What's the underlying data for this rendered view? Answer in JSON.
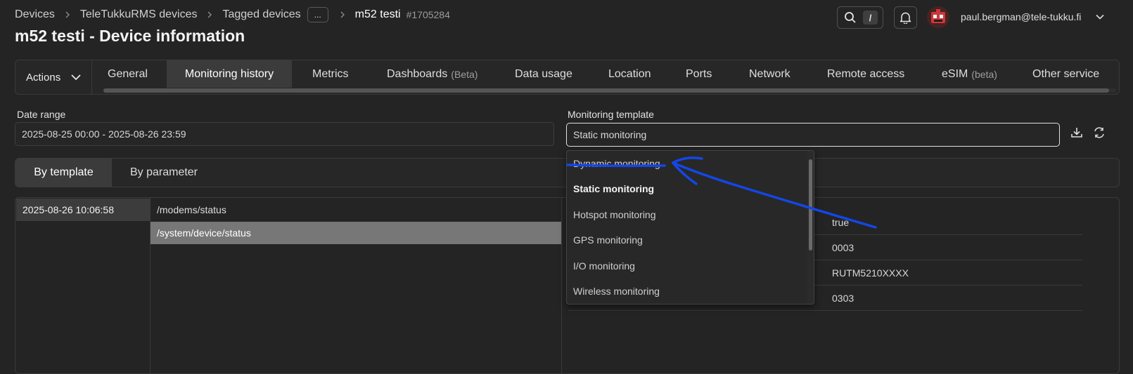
{
  "breadcrumb": {
    "items": [
      "Devices",
      "TeleTukkuRMS devices",
      "Tagged devices"
    ],
    "more": "...",
    "current": "m52 testi",
    "id": "#1705284"
  },
  "page": {
    "title": "m52 testi - Device information"
  },
  "header": {
    "search_key": "/",
    "user_email": "paul.bergman@tele-tukku.fi"
  },
  "actions": {
    "label": "Actions"
  },
  "tabs": [
    {
      "label": "General",
      "suffix": ""
    },
    {
      "label": "Monitoring history",
      "suffix": ""
    },
    {
      "label": "Metrics",
      "suffix": ""
    },
    {
      "label": "Dashboards",
      "suffix": "(Beta)"
    },
    {
      "label": "Data usage",
      "suffix": ""
    },
    {
      "label": "Location",
      "suffix": ""
    },
    {
      "label": "Ports",
      "suffix": ""
    },
    {
      "label": "Network",
      "suffix": ""
    },
    {
      "label": "Remote access",
      "suffix": ""
    },
    {
      "label": "eSIM",
      "suffix": "(beta)"
    },
    {
      "label": "Other service",
      "suffix": ""
    }
  ],
  "filters": {
    "date_range_label": "Date range",
    "date_range_value": "2025-08-25 00:00 - 2025-08-26 23:59",
    "template_label": "Monitoring template",
    "template_value": "Static monitoring"
  },
  "subtabs": [
    "By template",
    "By parameter"
  ],
  "times": [
    "2025-08-26 10:06:58"
  ],
  "paths": [
    "/modems/status",
    "/system/device/status"
  ],
  "values": [
    "true",
    "0003",
    "RUTM5210XXXX",
    "0303"
  ],
  "dropdown": {
    "options": [
      "Dynamic monitoring",
      "Static monitoring",
      "Hotspot monitoring",
      "GPS monitoring",
      "I/O monitoring",
      "Wireless monitoring"
    ],
    "selected": "Static monitoring"
  },
  "colors": {
    "annotation": "#1446e8",
    "background": "#242424",
    "active_tab": "#3b3b3b"
  }
}
